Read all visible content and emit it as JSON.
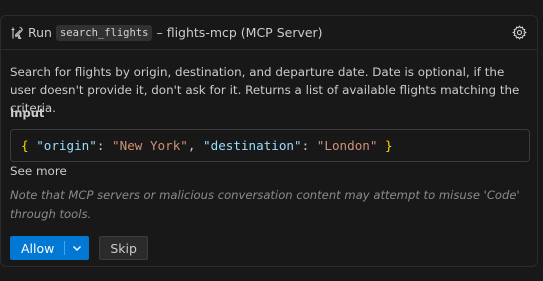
{
  "header": {
    "run_label": "Run",
    "tool_name": "search_flights",
    "server_label": "– flights-mcp (MCP Server)"
  },
  "description": "Search for flights by origin, destination, and departure date. Date is optional, if the user doesn't provide it, don't ask for it. Returns a list of available flights matching the criteria.",
  "input": {
    "label": "Input",
    "open_brace": "{",
    "key1": "\"origin\"",
    "colon1": ": ",
    "val1": "\"New York\"",
    "comma": ", ",
    "key2": "\"destination\"",
    "colon2": ": ",
    "val2": "\"London\"",
    "close_brace": "}"
  },
  "see_more": "See more",
  "note": "Note that MCP servers or malicious conversation content may attempt to misuse 'Code' through tools.",
  "actions": {
    "allow_label": "Allow",
    "skip_label": "Skip"
  },
  "icons": {
    "tool": "tools-icon",
    "settings": "gear-icon",
    "dropdown": "chevron-down-icon"
  },
  "colors": {
    "accent": "#0078d4",
    "json_key": "#9cdcfe",
    "json_string": "#ce9178",
    "json_brace": "#ffd700"
  }
}
